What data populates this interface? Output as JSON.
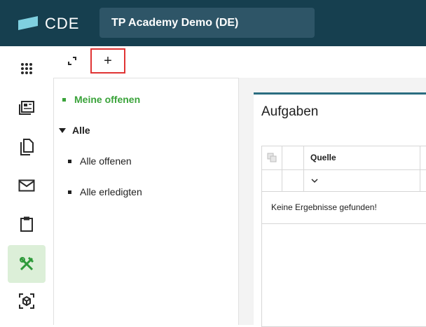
{
  "app": {
    "logo_text": "CDE",
    "project_name": "TP Academy Demo (DE)"
  },
  "sidebar": {
    "items": [
      {
        "icon": "apps-grid-icon"
      },
      {
        "icon": "news-icon"
      },
      {
        "icon": "documents-icon"
      },
      {
        "icon": "mail-icon"
      },
      {
        "icon": "clipboard-icon"
      },
      {
        "icon": "tools-icon",
        "active": true
      },
      {
        "icon": "model-3d-icon"
      }
    ]
  },
  "toolbar": {
    "expand_icon": "expand-icon",
    "add_label": "+"
  },
  "tree": {
    "items": [
      {
        "label": "Meine offenen",
        "active": true
      },
      {
        "label": "Alle"
      },
      {
        "label": "Alle offenen"
      },
      {
        "label": "Alle erledigten"
      }
    ]
  },
  "panel": {
    "title": "Aufgaben",
    "columns": [
      "Quelle"
    ],
    "empty_text": "Keine Ergebnisse gefunden!"
  },
  "colors": {
    "topbar": "#163f4f",
    "accent": "#3aa33a",
    "active_bg": "#dcefd8",
    "highlight": "#e03434"
  }
}
